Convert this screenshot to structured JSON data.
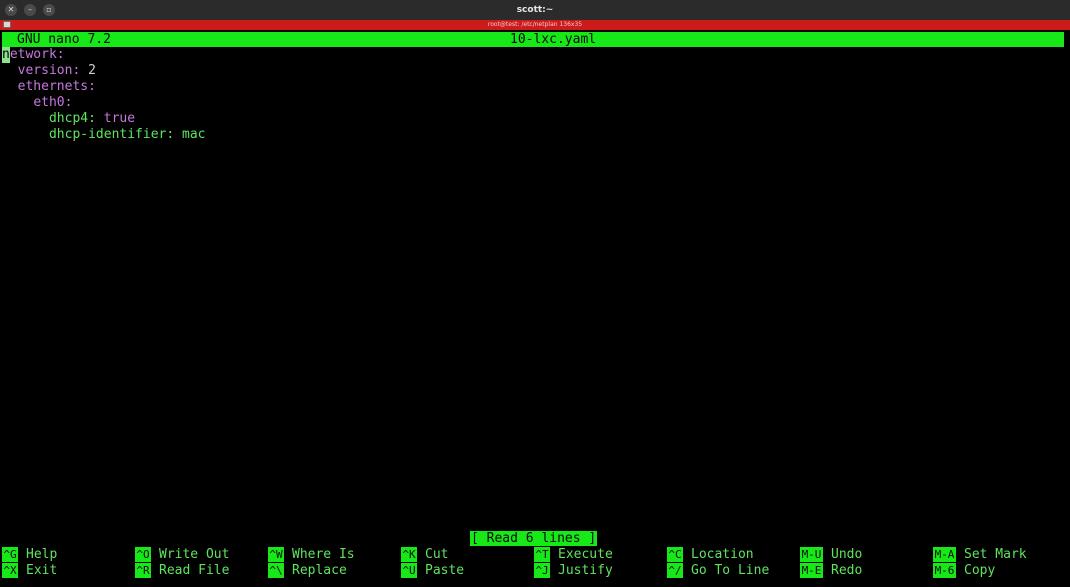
{
  "window": {
    "title": "scott:~",
    "buttons": {
      "close": "✕",
      "minimize": "–",
      "maximize": "▫"
    }
  },
  "tab": {
    "title": "root@test: /etc/netplan 136x35"
  },
  "nano": {
    "version": "GNU nano 7.2",
    "filename": "10-lxc.yaml",
    "status_message": "[ Read 6 lines ]"
  },
  "file_lines": [
    {
      "indent": "",
      "cursor_char": "n",
      "key": "etwork:",
      "value": ""
    },
    {
      "indent": "  ",
      "key": "version:",
      "value": "2"
    },
    {
      "indent": "  ",
      "key": "ethernets:",
      "value": ""
    },
    {
      "indent": "    ",
      "key": "eth0:",
      "value": ""
    },
    {
      "indent": "      ",
      "key": "dhcp4:",
      "value": "true"
    },
    {
      "indent": "      ",
      "key": "dhcp-identifier:",
      "value": "mac"
    }
  ],
  "shortcuts": {
    "row1": [
      {
        "key": "^G",
        "label": "Help"
      },
      {
        "key": "^O",
        "label": "Write Out"
      },
      {
        "key": "^W",
        "label": "Where Is"
      },
      {
        "key": "^K",
        "label": "Cut"
      },
      {
        "key": "^T",
        "label": "Execute"
      },
      {
        "key": "^C",
        "label": "Location"
      },
      {
        "key": "M-U",
        "label": "Undo"
      },
      {
        "key": "M-A",
        "label": "Set Mark"
      }
    ],
    "row2": [
      {
        "key": "^X",
        "label": "Exit"
      },
      {
        "key": "^R",
        "label": "Read File"
      },
      {
        "key": "^\\",
        "label": "Replace"
      },
      {
        "key": "^U",
        "label": "Paste"
      },
      {
        "key": "^J",
        "label": "Justify"
      },
      {
        "key": "^/",
        "label": "Go To Line"
      },
      {
        "key": "M-E",
        "label": "Redo"
      },
      {
        "key": "M-6",
        "label": "Copy"
      }
    ]
  },
  "colors": {
    "nano_bar": "#17e817",
    "tab_bar": "#cc1b1b",
    "key_text": "#c678dd",
    "value_text": "#5fe45f"
  }
}
